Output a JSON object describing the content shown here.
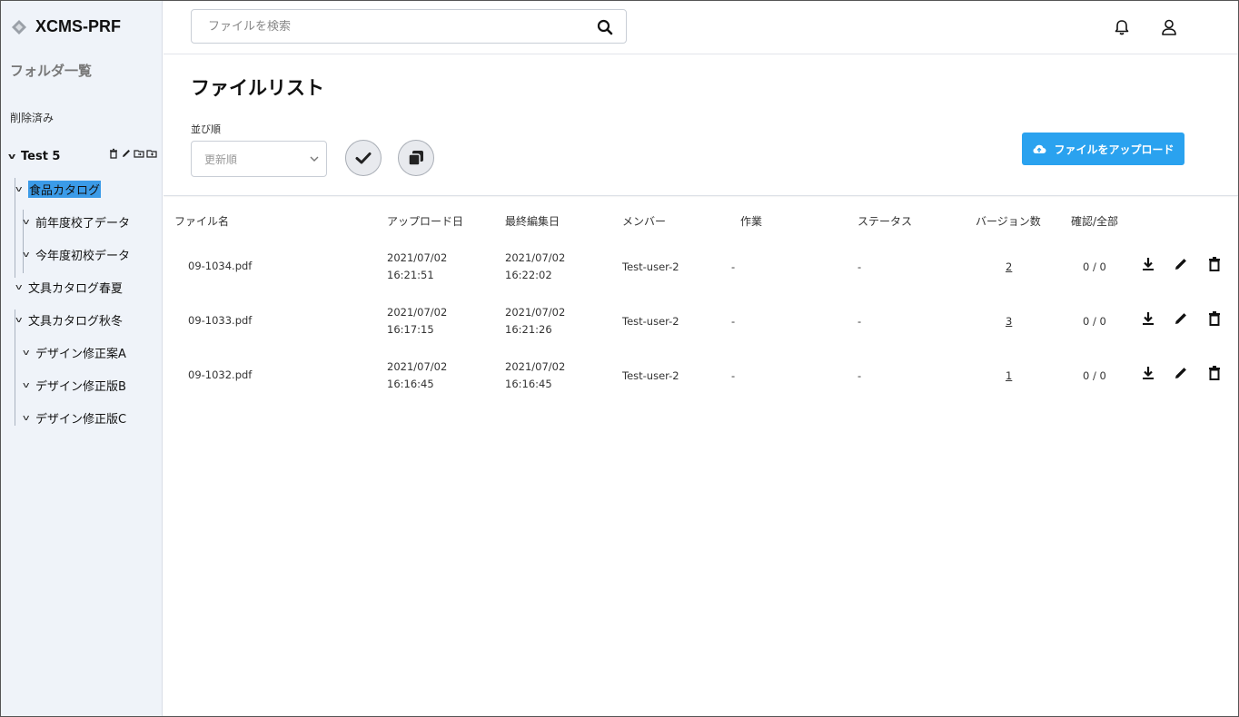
{
  "app": {
    "name": "XCMS-PRF"
  },
  "sidebar": {
    "heading": "フォルダ一覧",
    "deleted": "削除済み",
    "root": {
      "label": "Test 5"
    },
    "items": [
      {
        "label": "食品カタログ"
      },
      {
        "label": "前年度校了データ"
      },
      {
        "label": "今年度初校データ"
      },
      {
        "label": "文具カタログ春夏"
      },
      {
        "label": "文具カタログ秋冬"
      },
      {
        "label": "デザイン修正案A"
      },
      {
        "label": "デザイン修正版B"
      },
      {
        "label": "デザイン修正版C"
      }
    ],
    "selected": "食品カタログ"
  },
  "header": {
    "search_placeholder": "ファイルを検索",
    "icons": [
      "bell-icon",
      "user-icon"
    ]
  },
  "main": {
    "title": "ファイルリスト",
    "sort_label": "並び順",
    "sort_value": "更新順",
    "upload_label": "ファイルをアップロード",
    "accent_color": "#2aa2ef"
  },
  "table": {
    "columns": [
      "ファイル名",
      "アップロード日",
      "最終編集日",
      "メンバー",
      "作業",
      "ステータス",
      "バージョン数",
      "確認/全部"
    ],
    "rows": [
      {
        "file": "09-1034.pdf",
        "upload_date": "2021/07/02",
        "upload_time": "16:21:51",
        "edit_date": "2021/07/02",
        "edit_time": "16:22:02",
        "member": "Test-user-2",
        "work": "-",
        "status": "-",
        "versions": "2",
        "confirm": "0 / 0"
      },
      {
        "file": "09-1033.pdf",
        "upload_date": "2021/07/02",
        "upload_time": "16:17:15",
        "edit_date": "2021/07/02",
        "edit_time": "16:21:26",
        "member": "Test-user-2",
        "work": "-",
        "status": "-",
        "versions": "3",
        "confirm": "0 / 0"
      },
      {
        "file": "09-1032.pdf",
        "upload_date": "2021/07/02",
        "upload_time": "16:16:45",
        "edit_date": "2021/07/02",
        "edit_time": "16:16:45",
        "member": "Test-user-2",
        "work": "-",
        "status": "-",
        "versions": "1",
        "confirm": "0 / 0"
      }
    ]
  }
}
